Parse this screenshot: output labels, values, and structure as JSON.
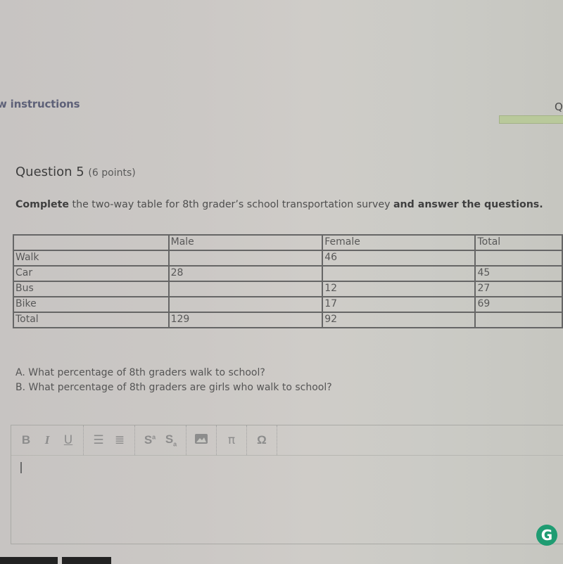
{
  "header": {
    "instructions_link": "w instructions",
    "right_label": "Q",
    "progress_color": "#b9c99b"
  },
  "question": {
    "title": "Question 5",
    "points": "(6 points)",
    "prompt_bold_1": "Complete",
    "prompt_text_1": " the two-way table for 8th grader’s school transportation survey ",
    "prompt_bold_2": "and answer the questions."
  },
  "table": {
    "headers": [
      "",
      "Male",
      "Female",
      "Total"
    ],
    "rows": [
      {
        "label": "Walk",
        "male": "",
        "female": "46",
        "total": ""
      },
      {
        "label": "Car",
        "male": "28",
        "female": "",
        "total": "45"
      },
      {
        "label": "Bus",
        "male": "",
        "female": "12",
        "total": "27"
      },
      {
        "label": "Bike",
        "male": "",
        "female": "17",
        "total": "69"
      },
      {
        "label": "Total",
        "male": "129",
        "female": "92",
        "total": ""
      }
    ]
  },
  "sub_questions": [
    "A. What percentage of 8th graders walk to school?",
    "B. What percentage of 8th graders are girls who walk to school?"
  ],
  "editor": {
    "toolbar": {
      "bold": "B",
      "italic": "I",
      "underline": "U",
      "bullet_list": "☰",
      "numbered_list": "≣",
      "superscript": "S",
      "superscript_mark": "a",
      "subscript": "S",
      "subscript_mark": "a",
      "image": "▨",
      "pi": "π",
      "omega": "Ω"
    },
    "content": "",
    "grammarly_label": "G",
    "grammarly_color": "#1f9c72"
  }
}
